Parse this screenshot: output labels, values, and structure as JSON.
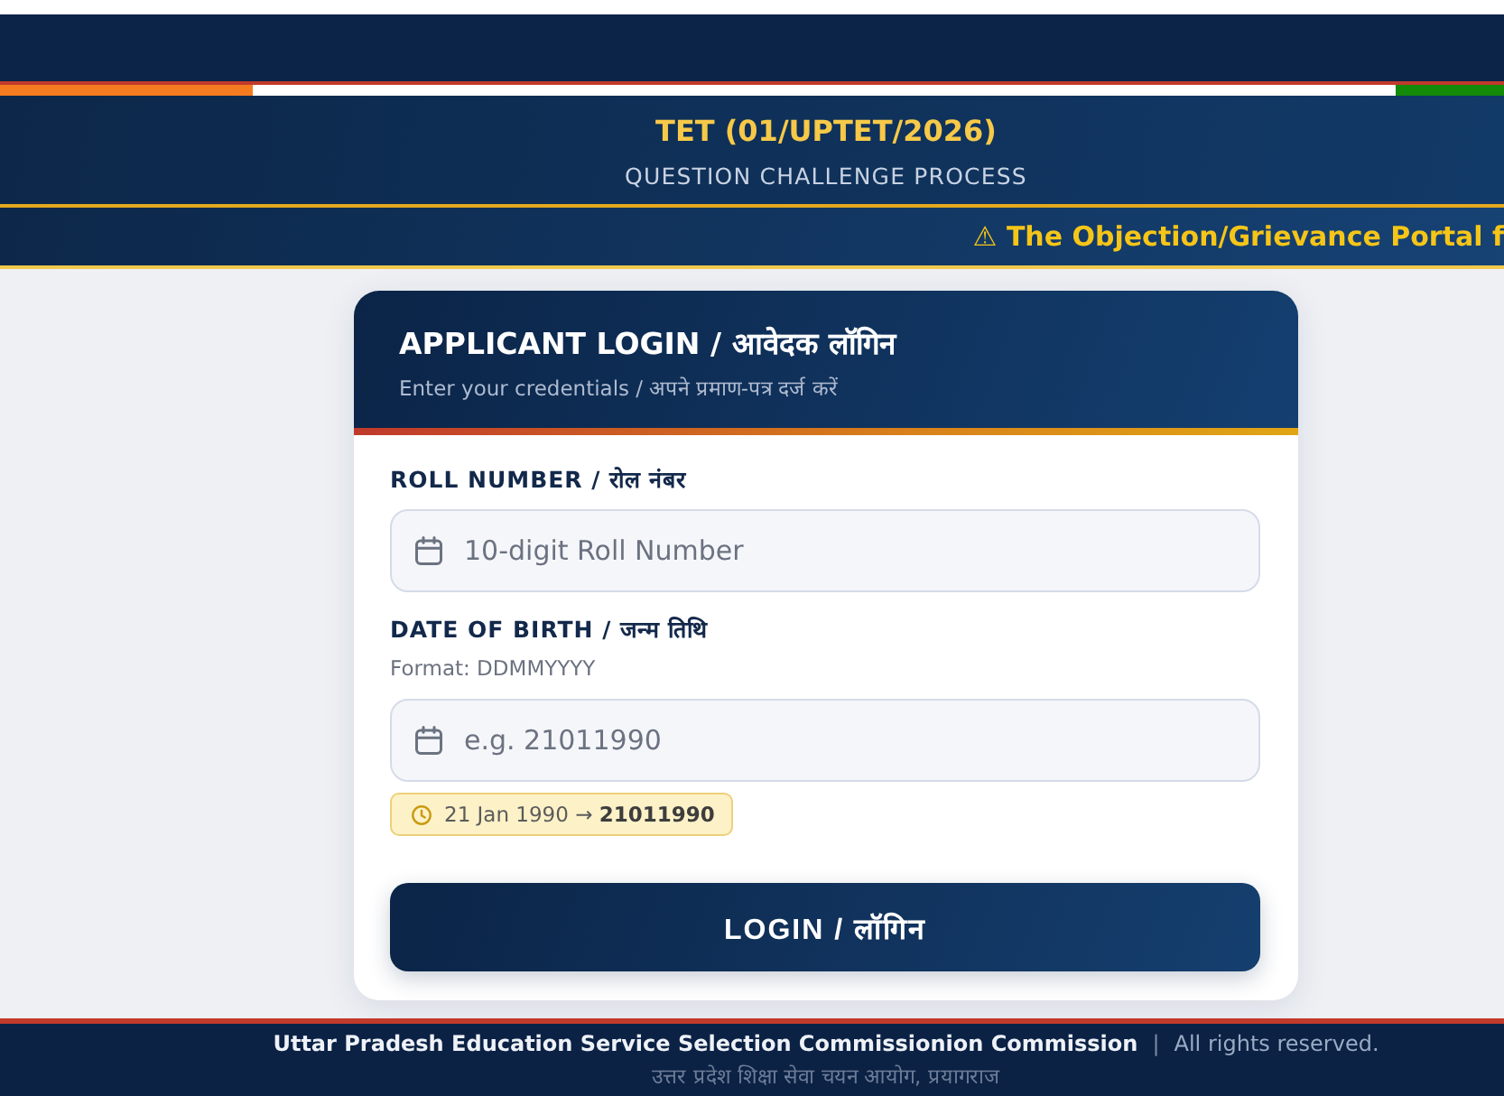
{
  "title_band": {
    "title": "TET (01/UPTET/2026)",
    "subtitle": "QUESTION CHALLENGE PROCESS"
  },
  "notice_ticker": {
    "text": "⚠ The Objection/Grievance Portal f"
  },
  "login_card": {
    "title": "APPLICANT LOGIN / आवेदक लॉगिन",
    "subtitle": "Enter your credentials / अपने प्रमाण-पत्र दर्ज करें",
    "fields": [
      {
        "label": "ROLL NUMBER / रोल नंबर",
        "placeholder": "10-digit Roll Number"
      },
      {
        "label": "DATE OF BIRTH / जन्म तिथि",
        "hint": "Format: DDMMYYYY",
        "placeholder": "e.g. 21011990",
        "example": "21 Jan 1990 → **21011990**"
      }
    ],
    "button": "LOGIN / लॉगिन"
  },
  "footer": {
    "organization": "Uttar Pradesh Education Service Selection Commissionion Commission",
    "separator": "|",
    "rights": "All rights reserved.",
    "organization_hindi": "उत्तर प्रदेश शिक्षा सेवा चयन आयोग, प्रयागराज"
  }
}
